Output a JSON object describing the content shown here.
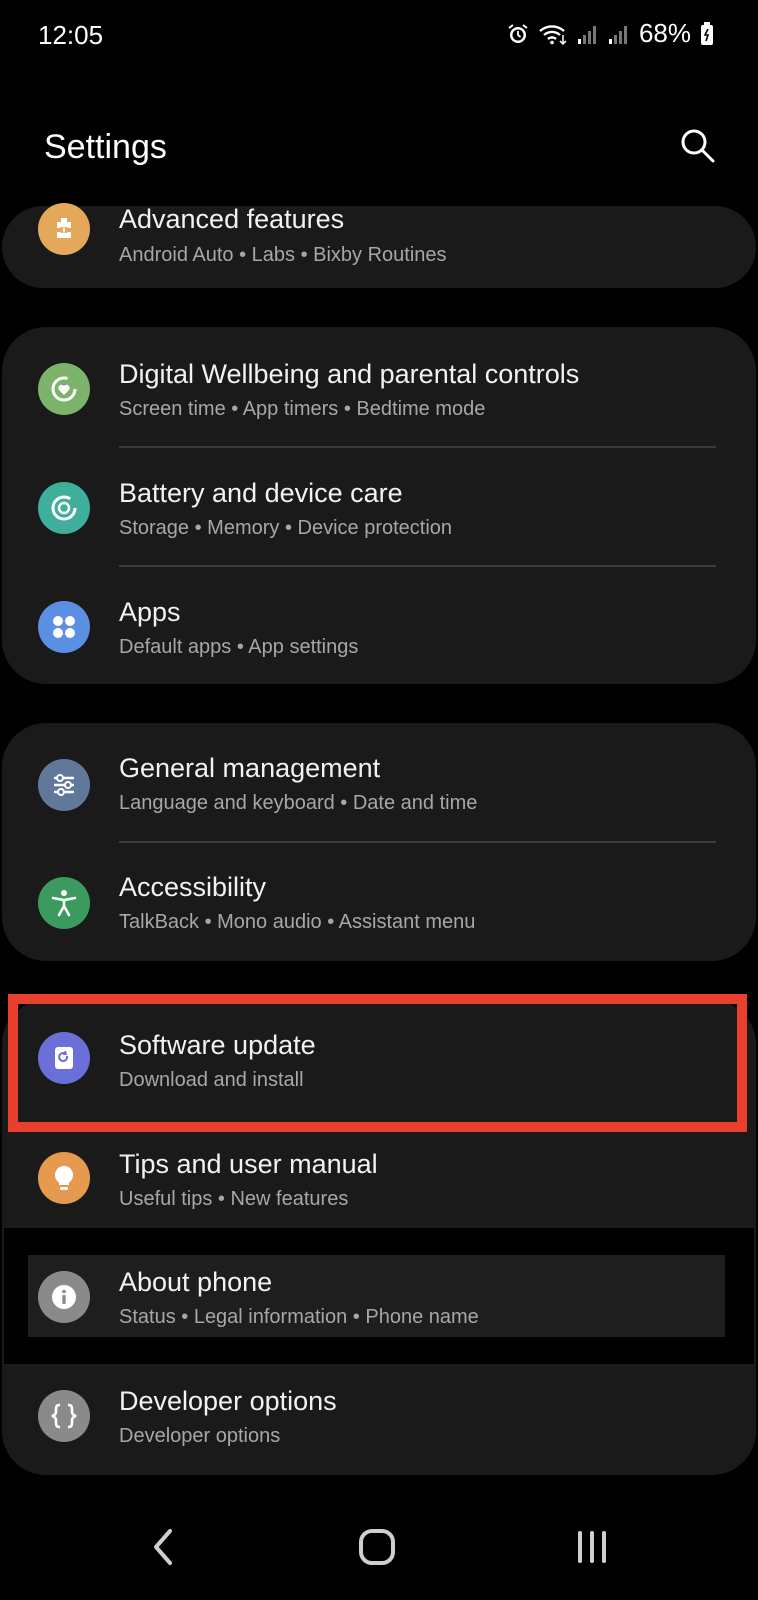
{
  "status_bar": {
    "time": "12:05",
    "battery": "68%"
  },
  "header": {
    "title": "Settings"
  },
  "sections": [
    {
      "items": [
        {
          "title": "Advanced features",
          "subtitle": "Android Auto  •  Labs  •  Bixby Routines",
          "icon": "puzzle-icon",
          "color": "#e3a85a"
        }
      ]
    },
    {
      "items": [
        {
          "title": "Digital Wellbeing and parental controls",
          "subtitle": "Screen time  •  App timers  •  Bedtime mode",
          "icon": "wellbeing-icon",
          "color": "#7cb36a"
        },
        {
          "title": "Battery and device care",
          "subtitle": "Storage  •  Memory  •  Device protection",
          "icon": "device-care-icon",
          "color": "#3fae9a"
        },
        {
          "title": "Apps",
          "subtitle": "Default apps  •  App settings",
          "icon": "apps-grid-icon",
          "color": "#5b8fe4"
        }
      ]
    },
    {
      "items": [
        {
          "title": "General management",
          "subtitle": "Language and keyboard  •  Date and time",
          "icon": "sliders-icon",
          "color": "#62789a"
        },
        {
          "title": "Accessibility",
          "subtitle": "TalkBack  •  Mono audio  •  Assistant menu",
          "icon": "accessibility-icon",
          "color": "#3d9a5f"
        }
      ]
    },
    {
      "items": [
        {
          "title": "Software update",
          "subtitle": "Download and install",
          "icon": "software-update-icon",
          "color": "#6b70d8"
        },
        {
          "title": "Tips and user manual",
          "subtitle": "Useful tips  •  New features",
          "icon": "lightbulb-icon",
          "color": "#e59a4f"
        },
        {
          "title": "About phone",
          "subtitle": "Status  •  Legal information  •  Phone name",
          "icon": "info-icon",
          "color": "#8a8a8a"
        },
        {
          "title": "Developer options",
          "subtitle": "Developer options",
          "icon": "braces-icon",
          "color": "#8a8a8a"
        }
      ]
    }
  ],
  "colors": {
    "background": "#000000",
    "card": "#1a1a1a",
    "highlight_border": "#e8402c"
  }
}
